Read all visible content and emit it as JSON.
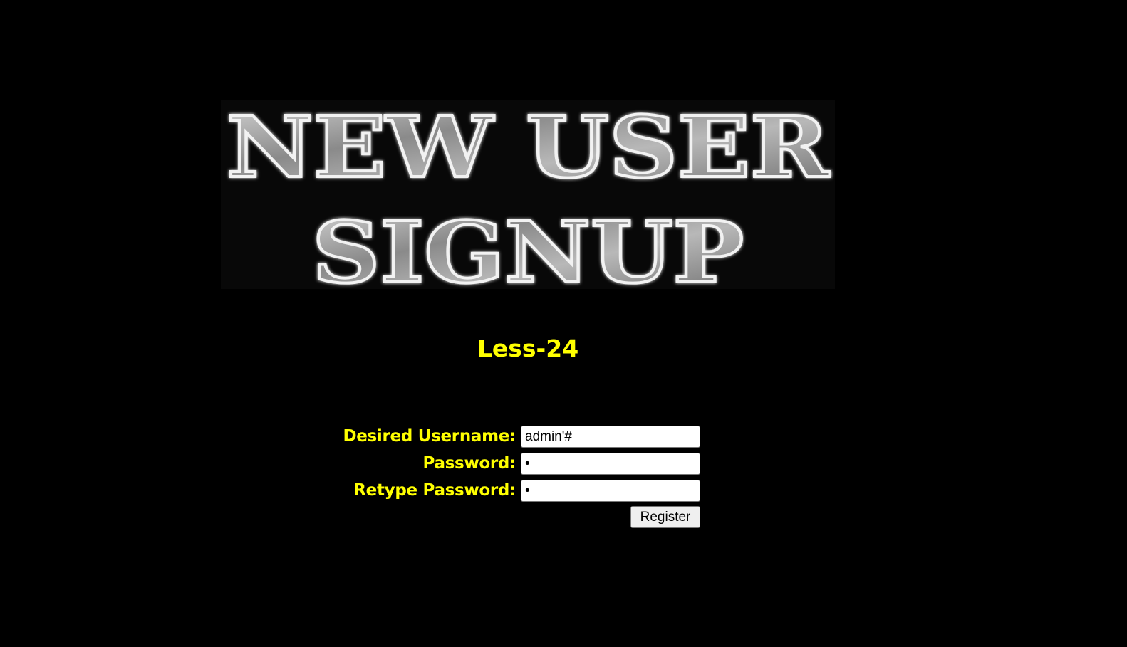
{
  "banner": {
    "line1": "NEW USER",
    "line2": "SIGNUP"
  },
  "lesson": {
    "title": "Less-24"
  },
  "form": {
    "username_label": "Desired Username:",
    "username_value": "admin'#",
    "password_label": "Password:",
    "password_value": "1",
    "retype_label": "Retype Password:",
    "retype_value": "1",
    "register_label": "Register"
  },
  "colors": {
    "background": "#000000",
    "accent": "#ffff00"
  }
}
